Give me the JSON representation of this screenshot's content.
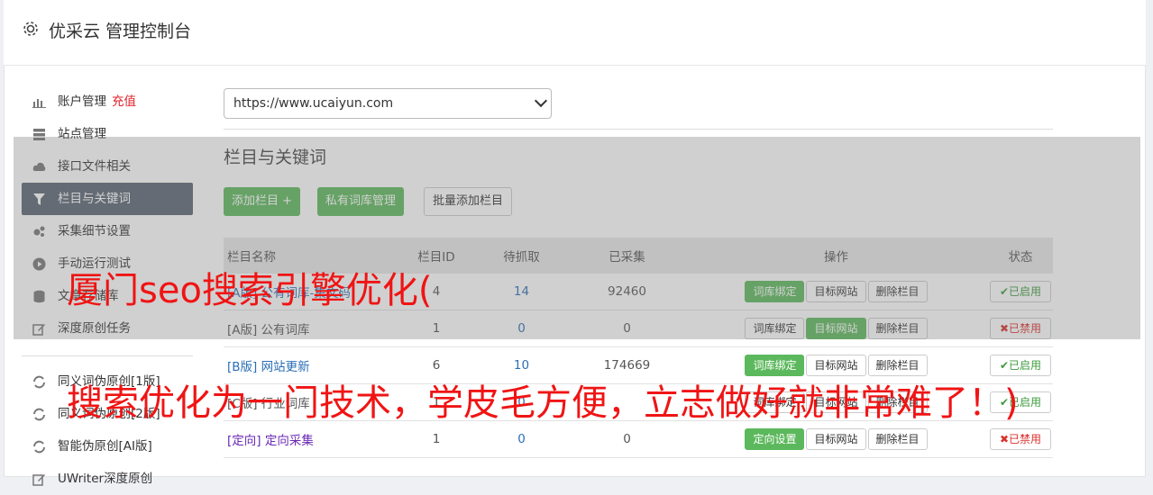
{
  "app": {
    "title": "优采云 管理控制台"
  },
  "sidebar": {
    "items": [
      {
        "label": "账户管理",
        "extra": "充值"
      },
      {
        "label": "站点管理"
      },
      {
        "label": "接口文件相关"
      },
      {
        "label": "栏目与关键词"
      },
      {
        "label": "采集细节设置"
      },
      {
        "label": "手动运行测试"
      },
      {
        "label": "文章存储库"
      },
      {
        "label": "深度原创任务"
      }
    ],
    "items2": [
      {
        "label": "同义词伪原创[1版]"
      },
      {
        "label": "同义词伪原创[2版]"
      },
      {
        "label": "智能伪原创[AI版]"
      },
      {
        "label": "UWriter深度原创"
      }
    ]
  },
  "main": {
    "site_select": "https://www.ucaiyun.com",
    "section_title": "栏目与关键词",
    "buttons": {
      "add": "添加栏目 +",
      "private": "私有词库管理",
      "batch": "批量添加栏目"
    },
    "table": {
      "headers": [
        "栏目名称",
        "栏目ID",
        "待抓取",
        "已采集",
        "操作",
        "状态"
      ],
      "rows": [
        {
          "name": "[A版] 公有词库-集文码",
          "id": "4",
          "pending": "14",
          "collected": "92460",
          "op1": "词库绑定",
          "op2": "目标网站",
          "op3": "删除栏目",
          "status": "已启用"
        },
        {
          "name": "[A版] 公有词库",
          "id": "1",
          "pending": "0",
          "collected": "0",
          "op1": "词库绑定",
          "op2": "目标网站",
          "op3": "删除栏目",
          "status": "已禁用"
        },
        {
          "name_tag": "[B版]",
          "name": "网站更新",
          "id": "6",
          "pending": "10",
          "collected": "174669",
          "op1": "词库绑定",
          "op2": "目标网站",
          "op3": "删除栏目",
          "status": "已启用"
        },
        {
          "name": "[C版] 行业词库",
          "id": "1",
          "pending": "0",
          "collected": "",
          "op1": "词库绑定",
          "op2": "目标网站",
          "op3": "删除栏目",
          "status": "已启用"
        },
        {
          "name_tag": "[定向]",
          "name": "定向采集",
          "id": "1",
          "pending": "0",
          "collected": "0",
          "op1": "定向设置",
          "op2": "目标网站",
          "op3": "删除栏目",
          "status": "已禁用"
        }
      ]
    }
  },
  "watermark": {
    "line1": "厦门seo搜索引擎优化(",
    "line2": "搜索优化为一门技术，学皮毛方便，立志做好就非常难了！)"
  },
  "colors": {
    "accent": "#5cb85c",
    "active_sidebar": "#5a6473",
    "watermark": "#f01414"
  }
}
